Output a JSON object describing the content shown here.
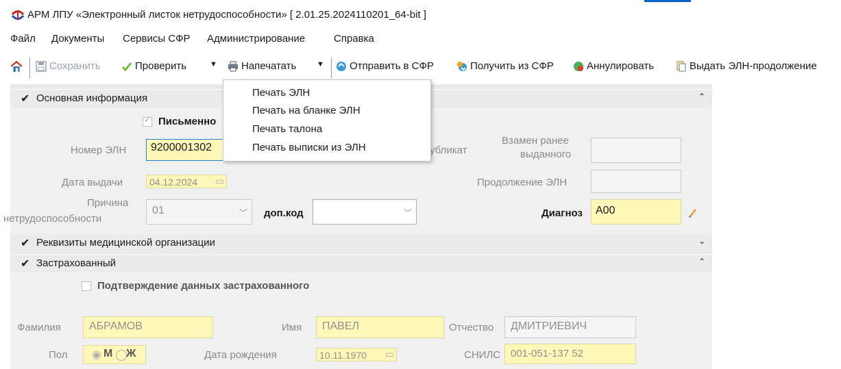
{
  "window": {
    "title": "АРМ ЛПУ «Электронный листок нетрудоспособности»  [ 2.01.25.2024110201_64-bit ]"
  },
  "menu": [
    "Файл",
    "Документы",
    "Сервисы СФР",
    "Администрирование",
    "Справка"
  ],
  "toolbar": {
    "save": "Сохранить",
    "check": "Проверить",
    "print": "Напечатать",
    "send": "Отправить в СФР",
    "receive": "Получить из СФР",
    "annul": "Аннулировать",
    "issue_continuation": "Выдать ЭЛН-продолжение"
  },
  "print_menu": [
    "Печать ЭЛН",
    "Печать на бланке ЭЛН",
    "Печать талона",
    "Печать выписки из ЭЛН"
  ],
  "sections": {
    "basic": "Основная информация",
    "medorg": "Реквизиты медицинской организации",
    "insured": "Застрахованный"
  },
  "basic": {
    "written_label": "Письменно",
    "number_label": "Номер ЭЛН",
    "number_value": "9200001302",
    "duplicate_label": "убликат",
    "replace_label_1": "Взамен ранее",
    "replace_label_2": "выданного",
    "issue_date_label": "Дата выдачи",
    "issue_date_value": "04.12.2024",
    "continuation_label": "Продолжение ЭЛН",
    "reason_label_1": "Причина",
    "reason_label_2": "нетрудоспособности",
    "reason_value": "01",
    "extra_code_label": "доп.код",
    "diagnosis_label": "Диагноз",
    "diagnosis_value": "A00"
  },
  "insured": {
    "confirm_label": "Подтверждение данных застрахованного",
    "surname_label": "Фамилия",
    "surname_value": "АБРАМОВ",
    "name_label": "Имя",
    "name_value": "ПАВЕЛ",
    "patronymic_label": "Отчество",
    "patronymic_value": "ДМИТРИЕВИЧ",
    "gender_label": "Пол",
    "gender_m": "М",
    "gender_f": "Ж",
    "birth_label": "Дата рождения",
    "birth_value": "10.11.1970",
    "snils_label": "СНИЛС",
    "snils_value": "001-051-137 52"
  }
}
